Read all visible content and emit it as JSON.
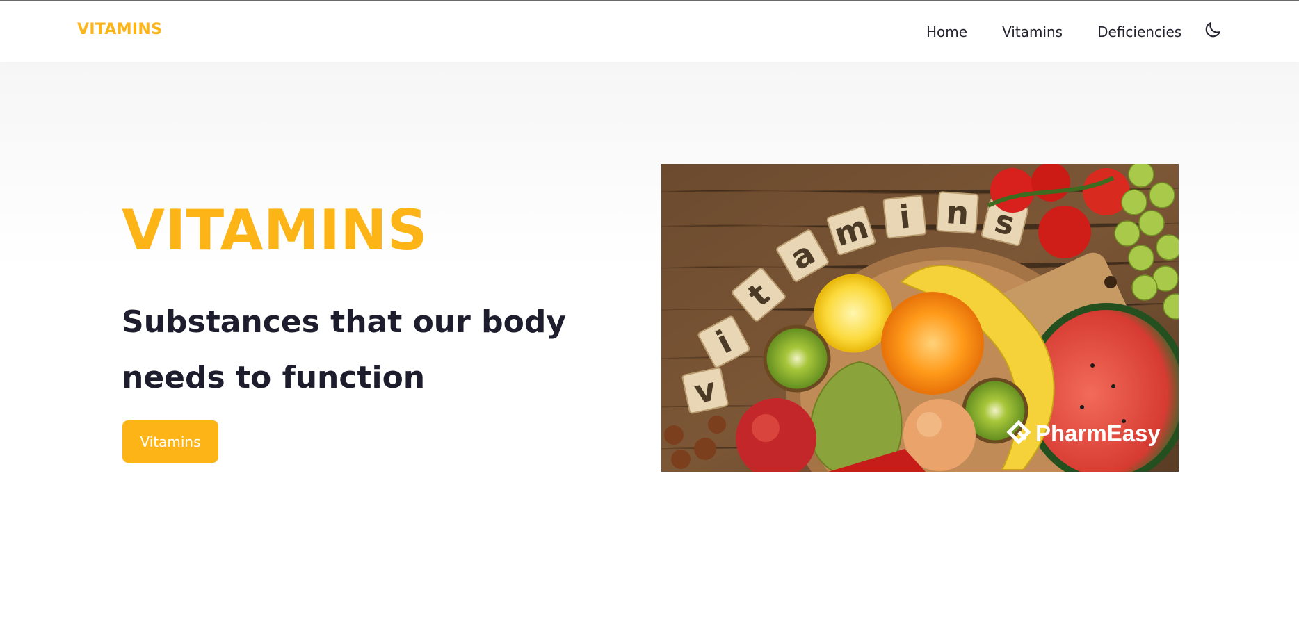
{
  "nav": {
    "brand": "VITAMINS",
    "links": [
      "Home",
      "Vitamins",
      "Deficiencies"
    ],
    "theme_toggle_icon": "moon-icon"
  },
  "hero": {
    "title": "VITAMINS",
    "subtitle": "Substances that our body needs to function",
    "button_label": "Vitamins",
    "image": {
      "letters": [
        "v",
        "i",
        "t",
        "a",
        "m",
        "i",
        "n",
        "s"
      ],
      "logo_text": "PharmEasy"
    }
  },
  "colors": {
    "accent": "#fdb416",
    "text_dark": "#1e1d2e",
    "background": "#ffffff"
  }
}
